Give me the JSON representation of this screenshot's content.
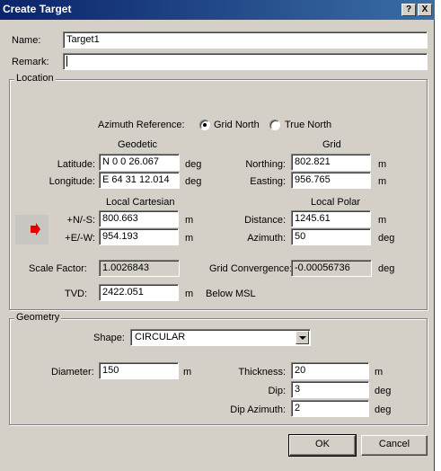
{
  "window": {
    "title": "Create Target",
    "help_label": "?",
    "close_label": "X"
  },
  "general": {
    "name_label": "Name:",
    "name_value": "Target1",
    "remark_label": "Remark:",
    "remark_value": ""
  },
  "location": {
    "group_label": "Location",
    "azimuth_reference_label": "Azimuth Reference:",
    "grid_north_label": "Grid North",
    "true_north_label": "True North",
    "selected_reference": "Grid North",
    "geodetic_header": "Geodetic",
    "grid_header": "Grid",
    "latitude_label": "Latitude:",
    "latitude_value": "N 0 0 26.067",
    "latitude_unit": "deg",
    "longitude_label": "Longitude:",
    "longitude_value": "E 64 31 12.014",
    "longitude_unit": "deg",
    "northing_label": "Northing:",
    "northing_value": "802.821",
    "northing_unit": "m",
    "easting_label": "Easting:",
    "easting_value": "956.765",
    "easting_unit": "m",
    "local_cartesian_header": "Local Cartesian",
    "local_polar_header": "Local Polar",
    "ns_label": "+N/-S:",
    "ns_value": "800.663",
    "ns_unit": "m",
    "ew_label": "+E/-W:",
    "ew_value": "954.193",
    "ew_unit": "m",
    "distance_label": "Distance:",
    "distance_value": "1245.61",
    "distance_unit": "m",
    "azimuth_label": "Azimuth:",
    "azimuth_value": "50",
    "azimuth_unit": "deg",
    "scale_factor_label": "Scale Factor:",
    "scale_factor_value": "1.0026843",
    "grid_convergence_label": "Grid Convergence:",
    "grid_convergence_value": "-0.00056736",
    "grid_convergence_unit": "deg",
    "tvd_label": "TVD:",
    "tvd_value": "2422.051",
    "tvd_unit": "m",
    "tvd_ref": "Below MSL"
  },
  "geometry": {
    "group_label": "Geometry",
    "shape_label": "Shape:",
    "shape_value": "CIRCULAR",
    "diameter_label": "Diameter:",
    "diameter_value": "150",
    "diameter_unit": "m",
    "thickness_label": "Thickness:",
    "thickness_value": "20",
    "thickness_unit": "m",
    "dip_label": "Dip:",
    "dip_value": "3",
    "dip_unit": "deg",
    "dip_azimuth_label": "Dip Azimuth:",
    "dip_azimuth_value": "2",
    "dip_azimuth_unit": "deg"
  },
  "buttons": {
    "ok_label": "OK",
    "cancel_label": "Cancel"
  },
  "colors": {
    "titlebar_start": "#0a246a",
    "titlebar_end": "#3a6ea5",
    "dialog_bg": "#d4d0c8",
    "arrow": "#e00000"
  },
  "icons": {
    "swap_arrow": "right-arrow-icon",
    "dropdown": "chevron-down-icon"
  }
}
